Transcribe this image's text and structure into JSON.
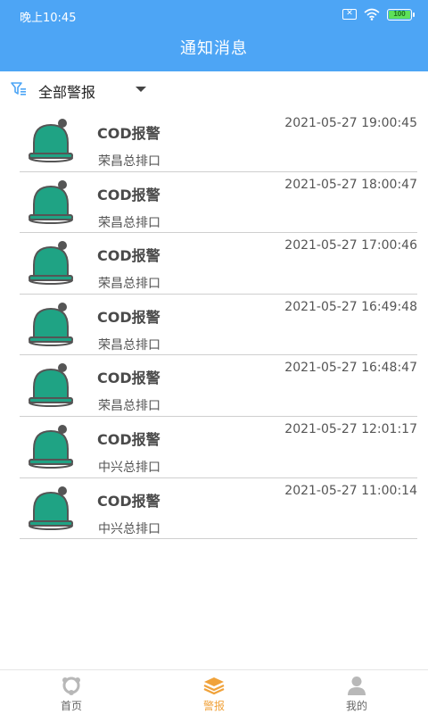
{
  "status_bar": {
    "time": "晚上10:45",
    "battery": "100"
  },
  "header": {
    "title": "通知消息"
  },
  "filter": {
    "label": "全部警报"
  },
  "colors": {
    "header_bg": "#4da5f5",
    "bell": "#1fa384",
    "active_tab": "#f0a23a"
  },
  "alerts": [
    {
      "title": "COD报警",
      "location": "荣昌总排口",
      "time": "2021-05-27 19:00:45"
    },
    {
      "title": "COD报警",
      "location": "荣昌总排口",
      "time": "2021-05-27 18:00:47"
    },
    {
      "title": "COD报警",
      "location": "荣昌总排口",
      "time": "2021-05-27 17:00:46"
    },
    {
      "title": "COD报警",
      "location": "荣昌总排口",
      "time": "2021-05-27 16:49:48"
    },
    {
      "title": "COD报警",
      "location": "荣昌总排口",
      "time": "2021-05-27 16:48:47"
    },
    {
      "title": "COD报警",
      "location": "中兴总排口",
      "time": "2021-05-27 12:01:17"
    },
    {
      "title": "COD报警",
      "location": "中兴总排口",
      "time": "2021-05-27 11:00:14"
    }
  ],
  "nav": {
    "items": [
      {
        "label": "首页",
        "icon": "home-icon"
      },
      {
        "label": "警报",
        "icon": "layers-icon"
      },
      {
        "label": "我的",
        "icon": "user-icon"
      }
    ],
    "active_index": 1
  }
}
